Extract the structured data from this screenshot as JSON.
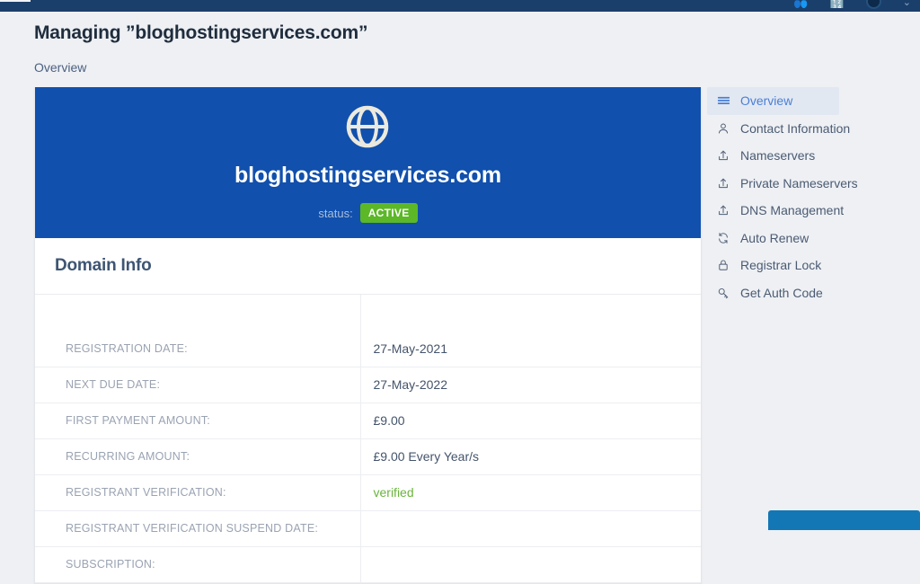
{
  "topbar": {
    "icons": [
      {
        "name": "users-icon",
        "glyph": "\u0000"
      },
      {
        "name": "calculator-icon",
        "glyph": "\u0000"
      }
    ],
    "caret": "⌄"
  },
  "header": {
    "title": "Managing ”bloghostingservices.com”",
    "breadcrumb": "Overview"
  },
  "hero": {
    "icon": "globe-icon",
    "domain": "bloghostingservices.com",
    "status_label": "status:",
    "status_value": "ACTIVE",
    "status_color": "#5cb827",
    "background_color": "#1150ad"
  },
  "card": {
    "section_title": "Domain Info",
    "rows": [
      {
        "key": "REGISTRATION DATE:",
        "value": "27-May-2021",
        "style": "normal"
      },
      {
        "key": "NEXT DUE DATE:",
        "value": "27-May-2022",
        "style": "normal"
      },
      {
        "key": "FIRST PAYMENT AMOUNT:",
        "value": "£9.00",
        "style": "normal"
      },
      {
        "key": "RECURRING AMOUNT:",
        "value": "£9.00 Every Year/s",
        "style": "normal"
      },
      {
        "key": "REGISTRANT VERIFICATION:",
        "value": "verified",
        "style": "green"
      },
      {
        "key": "REGISTRANT VERIFICATION SUSPEND DATE:",
        "value": "",
        "style": "normal"
      },
      {
        "key": "SUBSCRIPTION:",
        "value": "",
        "style": "normal"
      }
    ]
  },
  "sidebar": {
    "items": [
      {
        "label": "Overview",
        "icon": "list-icon",
        "active": true
      },
      {
        "label": "Contact Information",
        "icon": "user-icon",
        "active": false
      },
      {
        "label": "Nameservers",
        "icon": "upload-icon",
        "active": false
      },
      {
        "label": "Private Nameservers",
        "icon": "upload-icon",
        "active": false
      },
      {
        "label": "DNS Management",
        "icon": "upload-icon",
        "active": false
      },
      {
        "label": "Auto Renew",
        "icon": "refresh-icon",
        "active": false
      },
      {
        "label": "Registrar Lock",
        "icon": "lock-icon",
        "active": false
      },
      {
        "label": "Get Auth Code",
        "icon": "key-icon",
        "active": false
      }
    ]
  },
  "float_bar": {
    "name": "chat-widget-bar",
    "color": "#1477b5"
  }
}
